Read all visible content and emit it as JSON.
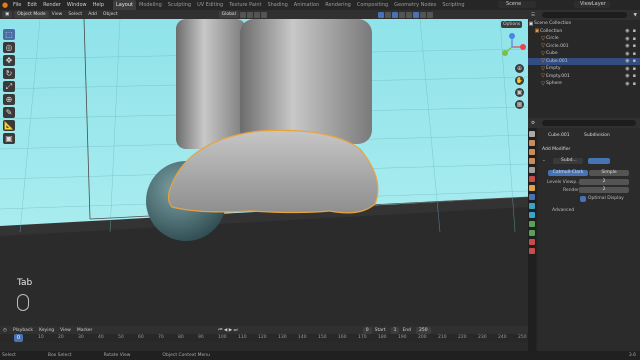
{
  "topbar": {
    "menus": [
      "File",
      "Edit",
      "Render",
      "Window",
      "Help"
    ],
    "workspaces": [
      "Layout",
      "Modeling",
      "Sculpting",
      "UV Editing",
      "Texture Paint",
      "Shading",
      "Animation",
      "Rendering",
      "Compositing",
      "Geometry Nodes",
      "Scripting"
    ],
    "active_workspace": "Layout",
    "scene": "Scene",
    "view_layer": "ViewLayer"
  },
  "viewport": {
    "mode": "Object Mode",
    "menus": [
      "View",
      "Select",
      "Add",
      "Object"
    ],
    "orientation": "Global",
    "options": "Options",
    "key_overlay": "Tab"
  },
  "outliner": {
    "root": "Scene Collection",
    "items": [
      {
        "name": "Collection"
      },
      {
        "name": "Circle"
      },
      {
        "name": "Circle.001"
      },
      {
        "name": "Cube"
      },
      {
        "name": "Cube.001",
        "selected": true
      },
      {
        "name": "Empty"
      },
      {
        "name": "Empty.001"
      },
      {
        "name": "Sphere"
      }
    ]
  },
  "properties": {
    "object": "Cube.001",
    "modifier_tab": "Subdivision",
    "add_modifier": "Add Modifier",
    "modifier_name": "Subd...",
    "catmull": "Catmull-Clark",
    "simple": "Simple",
    "levels_viewport_label": "Levels Viewp...",
    "levels_viewport": "2",
    "render_label": "Render",
    "render": "2",
    "optimal": "Optimal Display",
    "advanced": "Advanced"
  },
  "timeline": {
    "menus": [
      "Playback",
      "Keying",
      "View",
      "Marker"
    ],
    "current_frame": "0",
    "start_label": "Start",
    "start": "1",
    "end_label": "End",
    "end": "250",
    "ticks": [
      "0",
      "10",
      "20",
      "30",
      "40",
      "50",
      "60",
      "70",
      "80",
      "90",
      "100",
      "110",
      "120",
      "130",
      "140",
      "150",
      "160",
      "170",
      "180",
      "190",
      "200",
      "210",
      "220",
      "230",
      "240",
      "250"
    ],
    "playhead": "0"
  },
  "status": {
    "items": [
      "Select",
      "Box Select",
      "Rotate View",
      "Object Context Menu"
    ],
    "version": "3.6"
  },
  "colors": {
    "accent": "#4772b3",
    "selection": "#e8a33d",
    "background": "#1d1d1d"
  }
}
